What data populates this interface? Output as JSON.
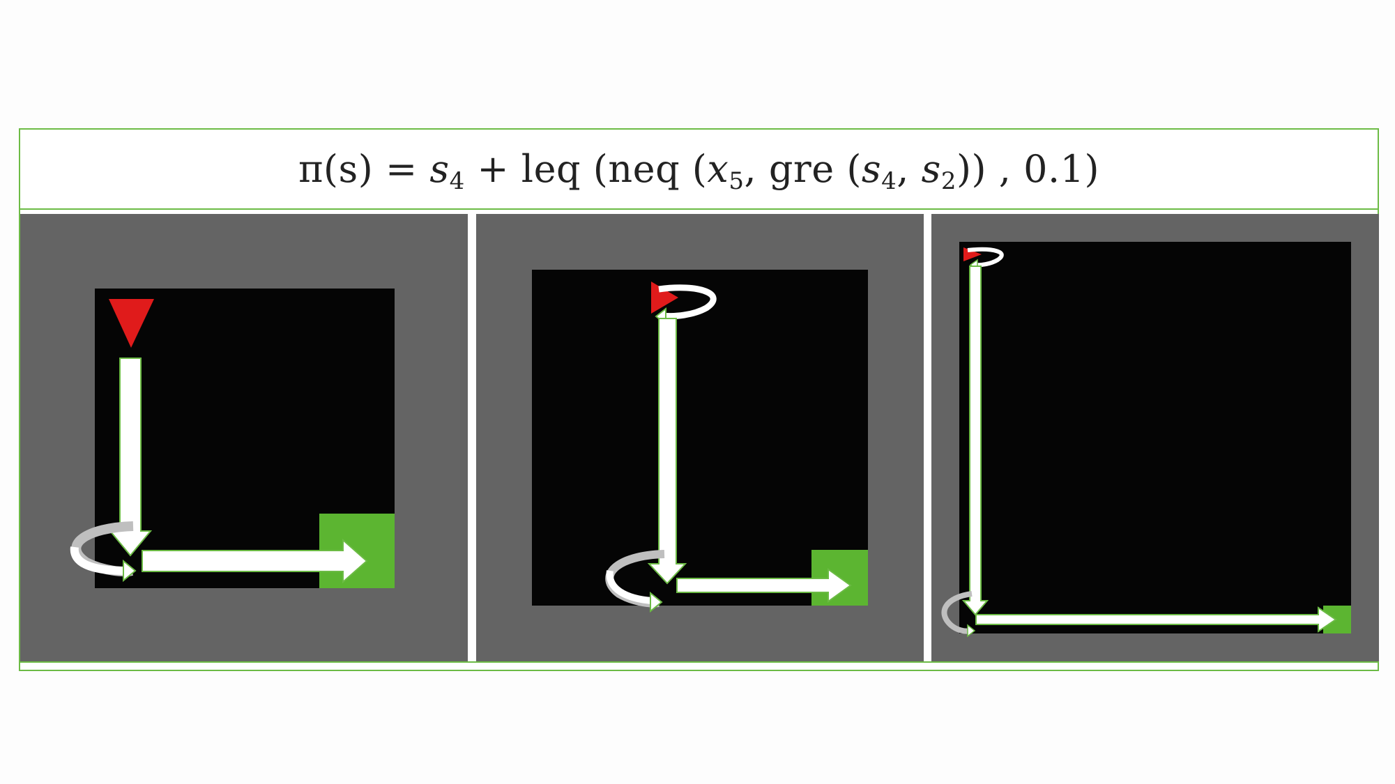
{
  "formula": {
    "lhs": "π(s) = ",
    "s4": "s",
    "s4_sub": "4",
    "plus": " + ",
    "leq": "leq",
    "open1": " (",
    "neq": "neq",
    "open2": " (",
    "x5": "x",
    "x5_sub": "5",
    "comma1": ", ",
    "gre": "gre",
    "open3": " (",
    "s4b": "s",
    "s4b_sub": "4",
    "comma2": ", ",
    "s2": "s",
    "s2_sub": "2",
    "close": ")) , 0.1)"
  },
  "panels": [
    {
      "name": "panel-small-grid"
    },
    {
      "name": "panel-medium-grid"
    },
    {
      "name": "panel-large-grid"
    }
  ],
  "colors": {
    "border": "#6cbb45",
    "panel_bg": "#646464",
    "grid_bg": "#050505",
    "agent": "#e01b1b",
    "goal": "#5cb531",
    "arrow": "#ffffff",
    "arrow_outline": "#6cbb45"
  },
  "icons": {
    "agent": "red-triangle-agent",
    "goal": "green-square-goal",
    "turn": "curved-rotate-arrow",
    "move": "straight-arrow"
  }
}
